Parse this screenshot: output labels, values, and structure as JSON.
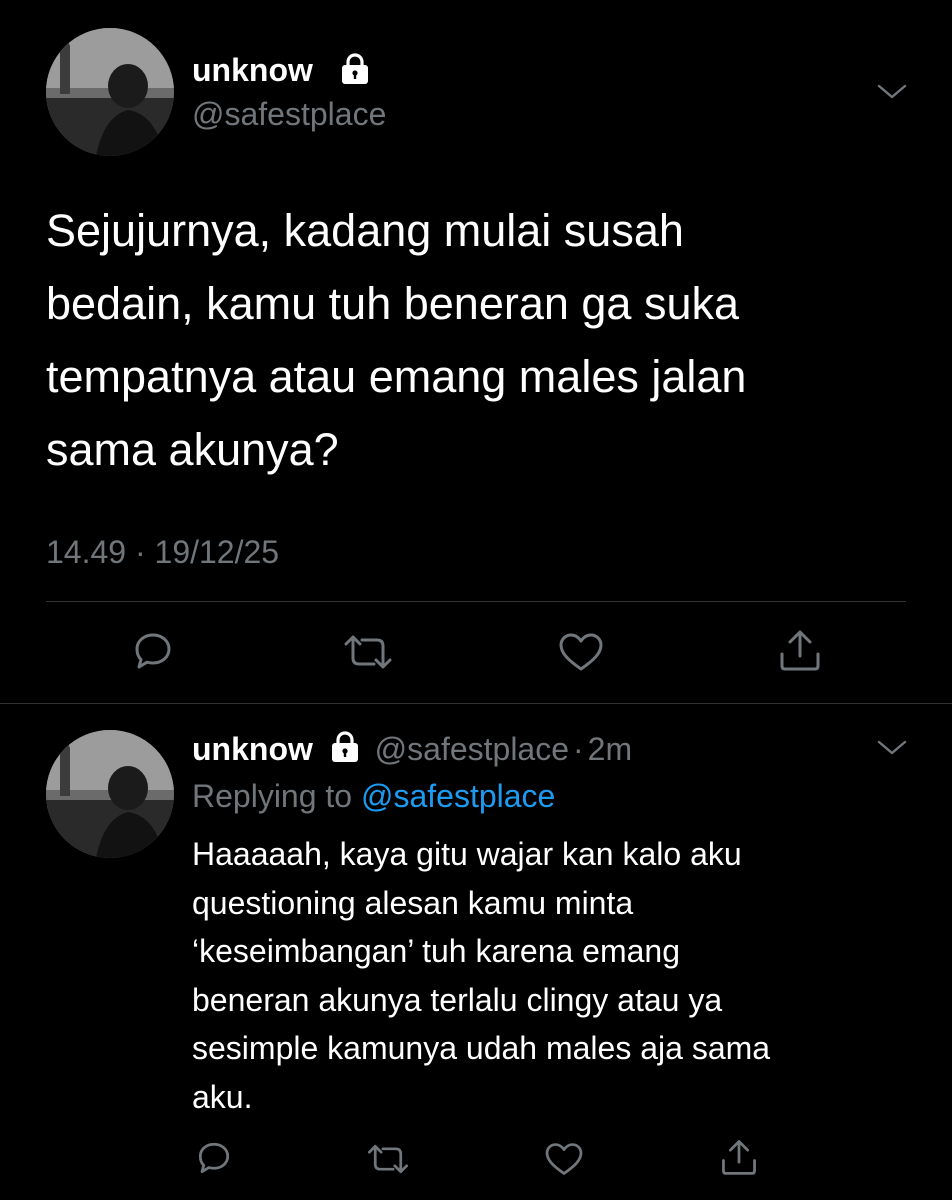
{
  "main_tweet": {
    "display_name": "unknow",
    "handle": "@safestplace",
    "text_lines": [
      "Sejujurnya, kadang mulai susah",
      "bedain, kamu tuh beneran ga suka",
      "tempatnya atau emang males jalan",
      "sama akunya?"
    ],
    "timestamp": "14.49 · 19/12/25"
  },
  "reply_tweet": {
    "display_name": "unknow",
    "handle": "@safestplace",
    "separator": "·",
    "time_ago": "2m",
    "replying_to_label": "Replying to",
    "replying_to_handle": "@safestplace",
    "text_lines": [
      "Haaaaah, kaya gitu wajar kan kalo aku",
      "questioning alesan kamu minta",
      "‘keseimbangan’ tuh karena emang",
      "beneran akunya terlalu clingy atau ya",
      "sesimple kamunya udah males aja sama",
      "aku."
    ]
  },
  "icons": {
    "lock": "lock-icon",
    "reply": "reply-icon",
    "retweet": "retweet-icon",
    "like": "heart-icon",
    "share": "share-icon",
    "more": "chevron-down-icon"
  },
  "colors": {
    "background": "#000000",
    "text": "#ffffff",
    "muted": "#71767b",
    "link": "#1d9bf0",
    "divider": "#2f3336"
  }
}
